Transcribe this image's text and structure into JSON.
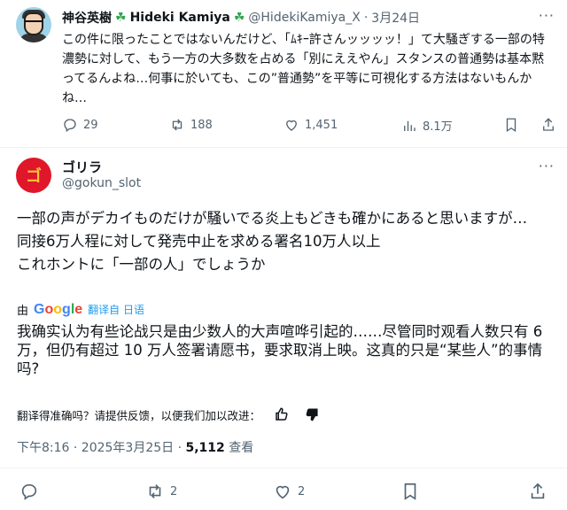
{
  "quoted": {
    "name": "神谷英樹",
    "name_en": "Hideki Kamiya",
    "handle": "@HidekiKamiya_X",
    "date": "3月24日",
    "text": "この件に限ったことではないんだけど、「ﾑｷｰ許さんッッッッ！」て大騒ぎする一部の特濃勢に対して、もう一方の大多数を占める「別にええやん」スタンスの普通勢は基本黙ってるんよね…何事に於いても、この”普通勢”を平等に可視化する方法はないもんかね…",
    "actions": {
      "replies": "29",
      "reposts": "188",
      "likes": "1,451",
      "views": "8.1万"
    }
  },
  "post": {
    "name": "ゴリラ",
    "handle": "@gokun_slot",
    "avatar_char": "ゴ",
    "text_lines": [
      "一部の声がデカイものだけが騒いでる炎上もどきも確かにあると思いますが…",
      "同接6万人程に対して発売中止を求める署名10万人以上",
      "これホントに「一部の人」でしょうか"
    ],
    "translate": {
      "by": "由",
      "google": "Google",
      "label": "翻译自 日语"
    },
    "translation": "我确实认为有些论战只是由少数人的大声喧哗引起的……尽管同时观看人数只有 6 万，但仍有超过 10 万人签署请愿书，要求取消上映。这真的只是“某些人”的事情吗?",
    "feedback_text": "翻译得准确吗？请提供反馈，以便我们加以改进：",
    "meta": {
      "time": "下午8:16 · 2025年3月25日 · ",
      "views_count": "5,112",
      "views_label": " 查看"
    },
    "actions": {
      "reposts": "2",
      "likes": "2"
    }
  },
  "icons": {
    "reply": "reply-icon",
    "repost": "repost-icon",
    "like": "heart-icon",
    "views": "views-chart-icon",
    "bookmark": "bookmark-icon",
    "share": "share-icon",
    "more": "more-dots-icon",
    "thumbs_up": "thumbs-up-icon",
    "thumbs_down": "thumbs-down-icon",
    "clover": "clover-icon"
  },
  "colors": {
    "text": "#0f1419",
    "secondary": "#536471",
    "accent": "#1d9bf0",
    "avatar_red": "#e0162b"
  }
}
